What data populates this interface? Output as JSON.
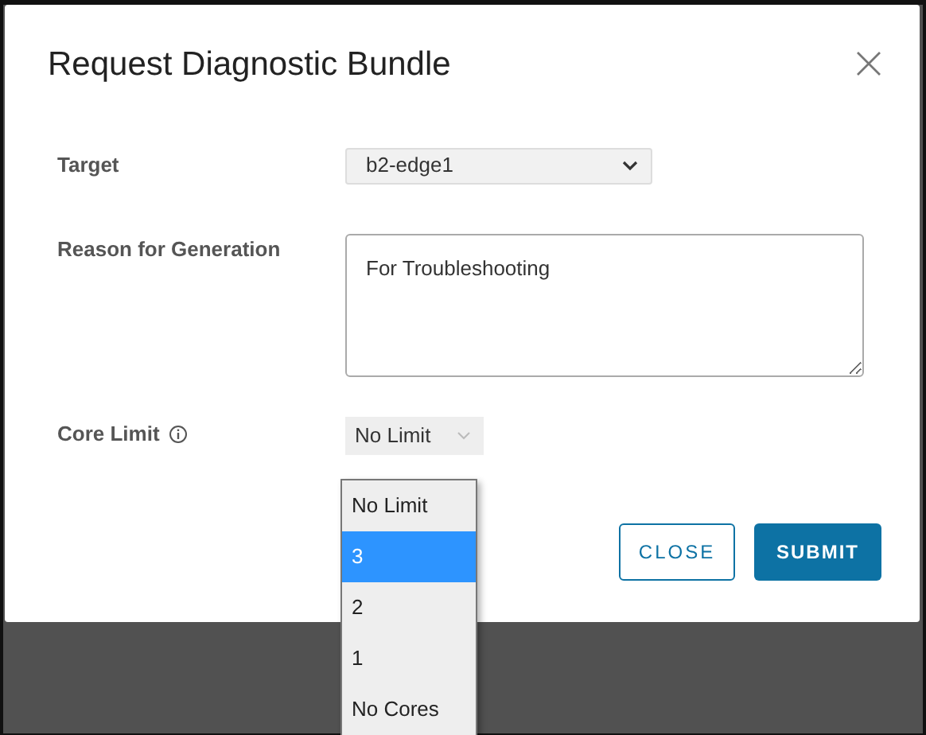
{
  "dialog": {
    "title": "Request Diagnostic Bundle"
  },
  "fields": [
    {
      "kind": "select",
      "label": "Target",
      "value": "b2-edge1"
    },
    {
      "kind": "textarea",
      "label": "Reason for Generation",
      "value": "For Troubleshooting"
    },
    {
      "kind": "select-small",
      "label": "Core Limit",
      "info": true,
      "value": "No Limit",
      "expanded": true,
      "options": [
        {
          "label": "No Limit",
          "highlighted": false
        },
        {
          "label": "3",
          "highlighted": true
        },
        {
          "label": "2",
          "highlighted": false
        },
        {
          "label": "1",
          "highlighted": false
        },
        {
          "label": "No Cores",
          "highlighted": false
        }
      ]
    }
  ],
  "buttons": [
    {
      "label": "CLOSE",
      "kind": "outline"
    },
    {
      "label": "SUBMIT",
      "kind": "primary"
    }
  ]
}
